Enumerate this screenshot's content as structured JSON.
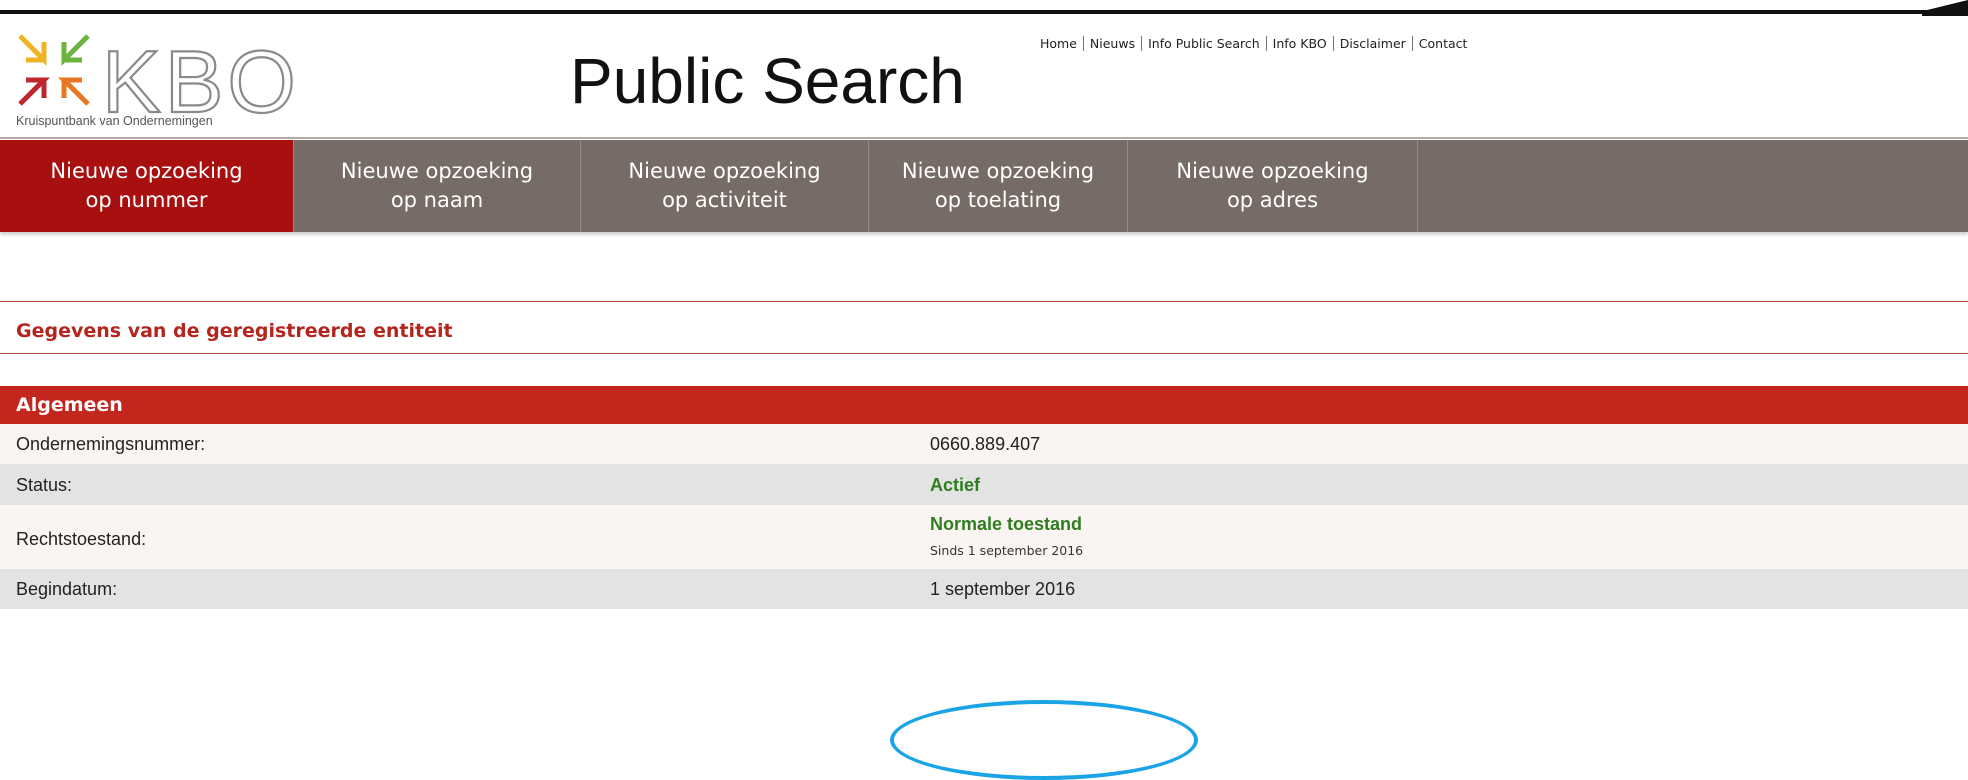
{
  "header": {
    "logo_text": "KBO",
    "logo_subtitle": "Kruispuntbank van Ondernemingen",
    "page_title": "Public Search",
    "top_links": [
      "Home",
      "Nieuws",
      "Info Public Search",
      "Info KBO",
      "Disclaimer",
      "Contact"
    ]
  },
  "nav": {
    "tabs": [
      {
        "line1": "Nieuwe opzoeking",
        "line2": "op nummer",
        "active": true
      },
      {
        "line1": "Nieuwe opzoeking",
        "line2": "op naam",
        "active": false
      },
      {
        "line1": "Nieuwe opzoeking",
        "line2": "op activiteit",
        "active": false
      },
      {
        "line1": "Nieuwe opzoeking",
        "line2": "op toelating",
        "active": false
      },
      {
        "line1": "Nieuwe opzoeking",
        "line2": "op adres",
        "active": false
      }
    ]
  },
  "section": {
    "title": "Gegevens van de geregistreerde entiteit"
  },
  "table": {
    "header": "Algemeen",
    "rows": {
      "ondernemingsnummer": {
        "label": "Ondernemingsnummer:",
        "value": "0660.889.407"
      },
      "status": {
        "label": "Status:",
        "value": "Actief"
      },
      "rechtstoestand": {
        "label": "Rechtstoestand:",
        "value": "Normale toestand",
        "sub": "Sinds 1 september 2016"
      },
      "begindatum": {
        "label": "Begindatum:",
        "value": "1 september 2016"
      }
    }
  },
  "colors": {
    "accent_red": "#c3261d",
    "active_tab": "#a80f0f",
    "nav_bg": "#766b65",
    "status_green": "#2e7d1e",
    "annotation_blue": "#1aa3e6"
  }
}
